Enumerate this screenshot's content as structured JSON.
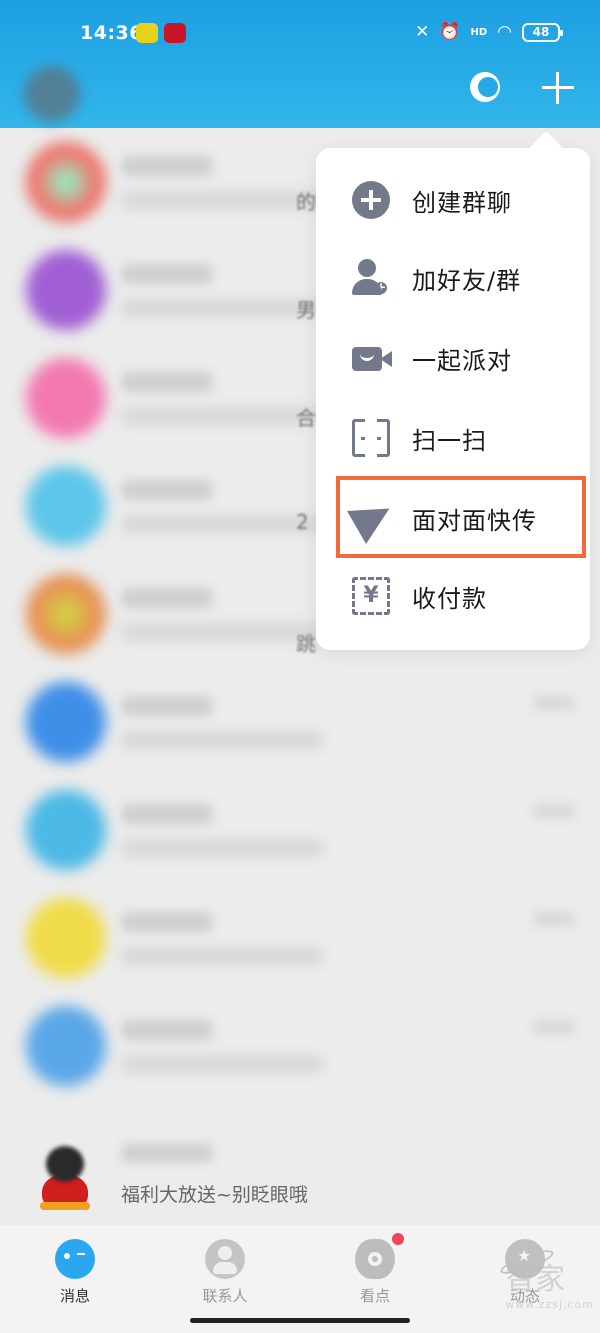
{
  "status_bar": {
    "time": "14:36",
    "battery": "48",
    "hd": "HD"
  },
  "menu": {
    "items": [
      {
        "label": "创建群聊",
        "icon": "add-group-icon"
      },
      {
        "label": "加好友/群",
        "icon": "add-friend-icon"
      },
      {
        "label": "一起派对",
        "icon": "party-camera-icon"
      },
      {
        "label": "扫一扫",
        "icon": "scan-icon"
      },
      {
        "label": "面对面快传",
        "icon": "paper-plane-icon",
        "highlighted": true
      },
      {
        "label": "收付款",
        "icon": "payment-icon"
      }
    ],
    "highlight_color": "#f06a3a"
  },
  "list_fragments": [
    "的",
    "男生",
    "合",
    "2",
    "跳"
  ],
  "last_message": "福利大放送~别眨眼哦",
  "tabs": [
    {
      "label": "消息",
      "icon": "message-icon",
      "active": true
    },
    {
      "label": "联系人",
      "icon": "contacts-icon"
    },
    {
      "label": "看点",
      "icon": "eye-icon",
      "badge": true
    },
    {
      "label": "动态",
      "icon": "planet-icon"
    }
  ],
  "watermark": {
    "text": "智家",
    "sub": "www.zzsj.com"
  },
  "colors": {
    "header": "#1d9fe2",
    "accent": "#2aa7ee",
    "badge": "#f0455c"
  }
}
